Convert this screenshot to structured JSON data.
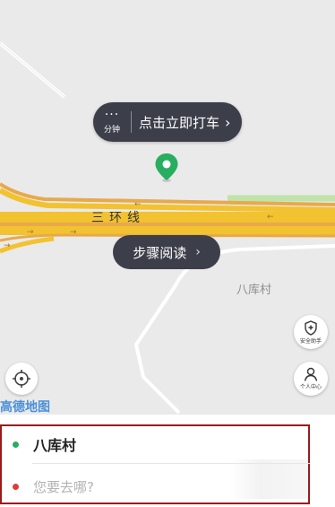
{
  "map": {
    "eta_dots": "···",
    "eta_unit": "分钟",
    "call_car_cta": "点击立即打车",
    "road_name": "三环线",
    "place_name": "八库村",
    "steps_button": "步骤阅读",
    "safety_caption": "安全助手",
    "profile_caption": "个人中心",
    "provider_logo": "高德地图"
  },
  "trip": {
    "from_label": "八库村",
    "to_placeholder": "您要去哪?"
  },
  "colors": {
    "bubble_bg": "#3c3f4a",
    "pin_green": "#27ae60",
    "origin_dot": "#27ae60",
    "destination_dot": "#e03b3b",
    "highway": "#f2c230",
    "frame": "#9b1b1b"
  }
}
